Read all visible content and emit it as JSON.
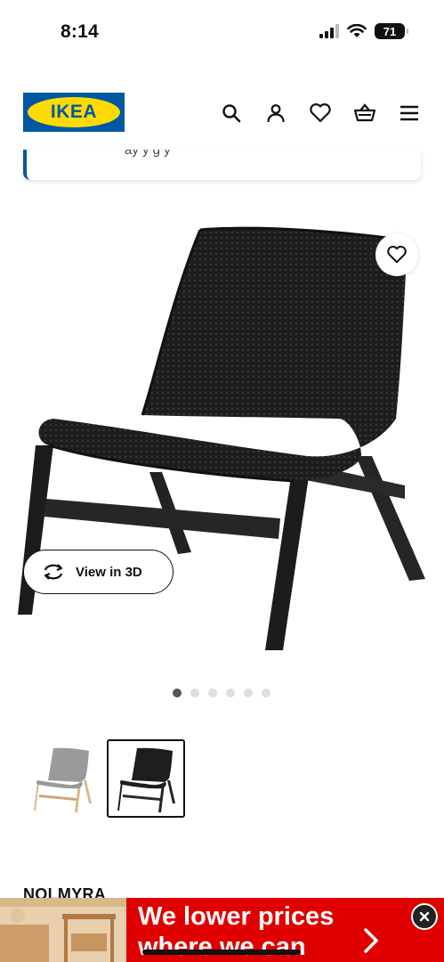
{
  "status_bar": {
    "time": "8:14",
    "battery": "71"
  },
  "header": {
    "logo_text": "IKEA",
    "icons": [
      "search-icon",
      "account-icon",
      "heart-icon",
      "basket-icon",
      "menu-icon"
    ]
  },
  "notice": {
    "text": "ay y g y"
  },
  "product": {
    "view_3d_label": "View in 3D",
    "image_count": 6,
    "active_image": 1,
    "name": "NOLMYRA"
  },
  "ad": {
    "line1": "We lower prices",
    "line2": "where we can",
    "color": "#e00000"
  },
  "colors": {
    "ikea_blue": "#0058a3",
    "ikea_yellow": "#ffdb00"
  }
}
